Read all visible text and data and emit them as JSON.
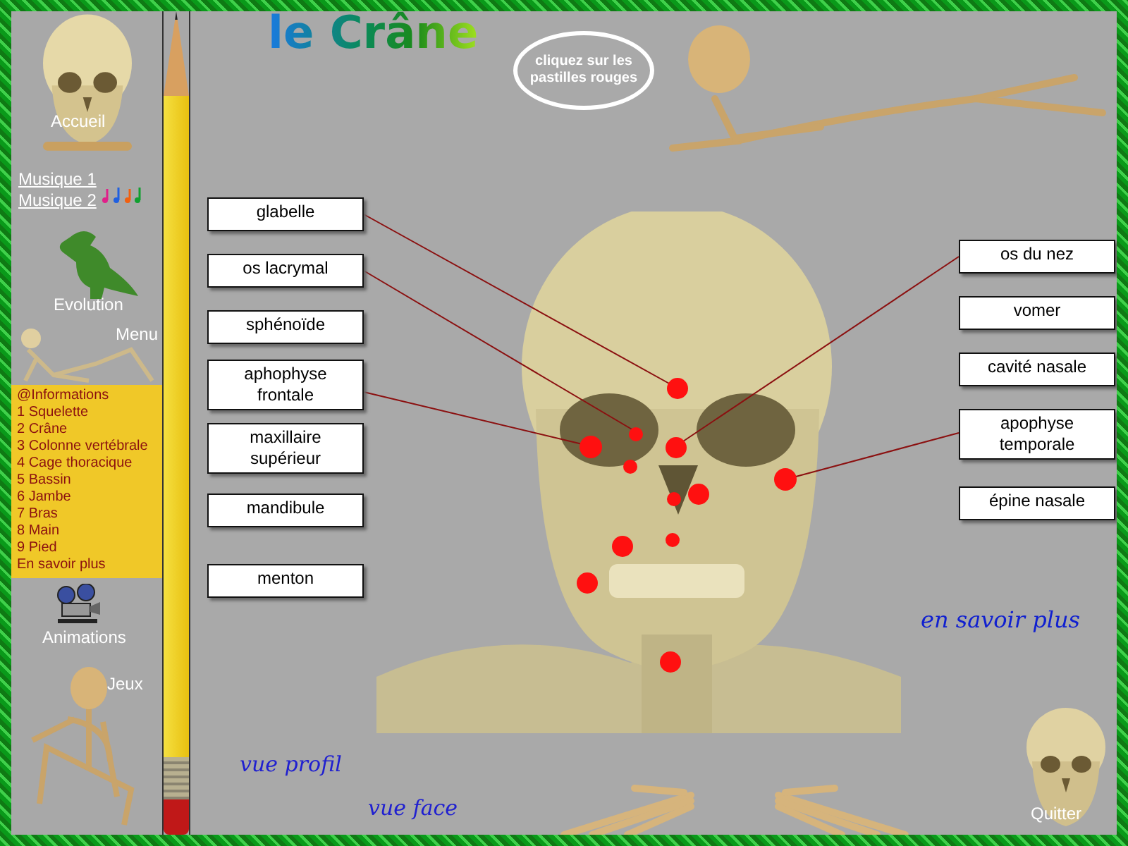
{
  "title": "le Crâne",
  "sidebar": {
    "home": "Accueil",
    "music_links": [
      "Musique 1",
      "Musique 2"
    ],
    "evolution": "Evolution",
    "menu_label": "Menu",
    "menu": [
      "@Informations",
      "1 Squelette",
      "2 Crâne",
      "3 Colonne vertébrale",
      "4 Cage thoracique",
      "5 Bassin",
      "6 Jambe",
      "7 Bras",
      "8 Main",
      "9 Pied",
      "En savoir plus"
    ],
    "animations": "Animations",
    "games": "Jeux"
  },
  "speech_bubble": "cliquez sur les pastilles rouges",
  "labels_left": [
    "glabelle",
    "os lacrymal",
    "sphénoïde",
    "aphophyse frontale",
    "maxillaire supérieur",
    "mandibule",
    "menton"
  ],
  "labels_right": [
    "os du nez",
    "vomer",
    "cavité nasale",
    "apophyse temporale",
    "épine nasale"
  ],
  "more_link": "en savoir plus",
  "view_links": [
    "vue profil",
    "vue face"
  ],
  "quit": "Quitter"
}
